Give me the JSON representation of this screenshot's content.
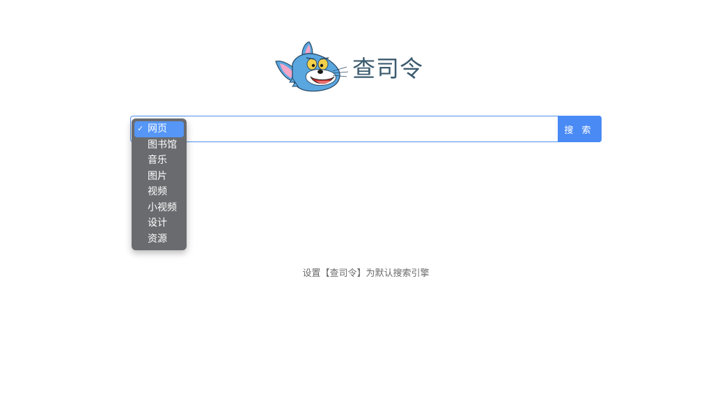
{
  "logo": {
    "title": "查司令",
    "mascot": "tom-cat-head-logo"
  },
  "search": {
    "placeholder": "",
    "value": "",
    "button_label": "搜 索",
    "category_menu": {
      "selected": "网页",
      "selected_icon": "check-icon",
      "items": [
        "网页",
        "图书馆",
        "音乐",
        "图片",
        "视频",
        "小视频",
        "设计",
        "资源"
      ]
    }
  },
  "footer": {
    "set_default_text": "设置【查司令】为默认搜索引擎"
  },
  "colors": {
    "accent": "#4a8af4",
    "menu_bg": "#6a6b6f",
    "menu_selected": "#5596f7",
    "title": "#3b5a6e"
  }
}
